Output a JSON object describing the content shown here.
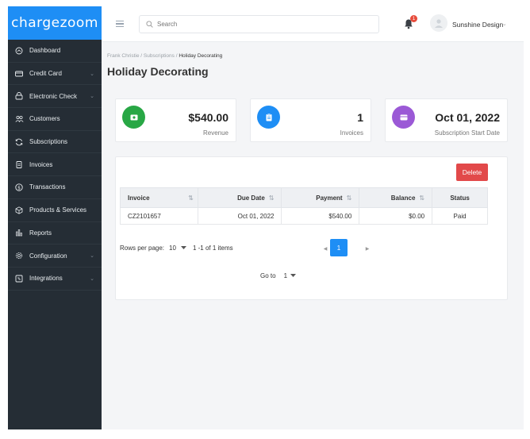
{
  "app": {
    "logo_text": "chargezoom"
  },
  "sidebar": {
    "items": [
      {
        "label": "Dashboard",
        "icon": "home-icon",
        "has_chevron": false
      },
      {
        "label": "Credit Card",
        "icon": "credit-card-icon",
        "has_chevron": true
      },
      {
        "label": "Electronic Check",
        "icon": "bank-icon",
        "has_chevron": true
      },
      {
        "label": "Customers",
        "icon": "users-icon",
        "has_chevron": false
      },
      {
        "label": "Subscriptions",
        "icon": "refresh-icon",
        "has_chevron": false
      },
      {
        "label": "Invoices",
        "icon": "clipboard-icon",
        "has_chevron": false
      },
      {
        "label": "Transactions",
        "icon": "dollar-circle-icon",
        "has_chevron": false
      },
      {
        "label": "Products & Services",
        "icon": "box-icon",
        "has_chevron": false
      },
      {
        "label": "Reports",
        "icon": "bar-chart-icon",
        "has_chevron": false
      },
      {
        "label": "Configuration",
        "icon": "gear-icon",
        "has_chevron": true
      },
      {
        "label": "Integrations",
        "icon": "puzzle-icon",
        "has_chevron": true
      }
    ],
    "chevron": "⌄"
  },
  "topbar": {
    "search_placeholder": "Search",
    "notification_count": "1",
    "user_name": "Sunshine Design"
  },
  "breadcrumb": {
    "part1": "Frank Christie",
    "sep": " / ",
    "part2": "Subscriptions",
    "current": "Holiday Decorating"
  },
  "page": {
    "title": "Holiday Decorating"
  },
  "stats": [
    {
      "value": "$540.00",
      "label": "Revenue",
      "color": "#28a745",
      "icon": "money-icon"
    },
    {
      "value": "1",
      "label": "Invoices",
      "color": "#1e8ef5",
      "icon": "clipboard-icon"
    },
    {
      "value": "Oct 01, 2022",
      "label": "Subscription Start Date",
      "color": "#9b59d6",
      "icon": "calendar-card-icon"
    }
  ],
  "actions": {
    "delete_label": "Delete"
  },
  "table": {
    "headers": [
      "Invoice",
      "Due Date",
      "Payment",
      "Balance",
      "Status"
    ],
    "sort_glyph": "⇅",
    "rows": [
      {
        "invoice": "CZ2101657",
        "due_date": "Oct 01, 2022",
        "payment": "$540.00",
        "balance": "$0.00",
        "status": "Paid"
      }
    ]
  },
  "pagination": {
    "rows_per_page_label": "Rows per page:",
    "rows_per_page_value": "10",
    "range_text": "1 -1 of 1 items",
    "current_page": "1",
    "goto_label": "Go to",
    "goto_value": "1"
  },
  "colors": {
    "accent": "#1e8ef5",
    "sidebar": "#252d35",
    "danger": "#e2494a"
  }
}
